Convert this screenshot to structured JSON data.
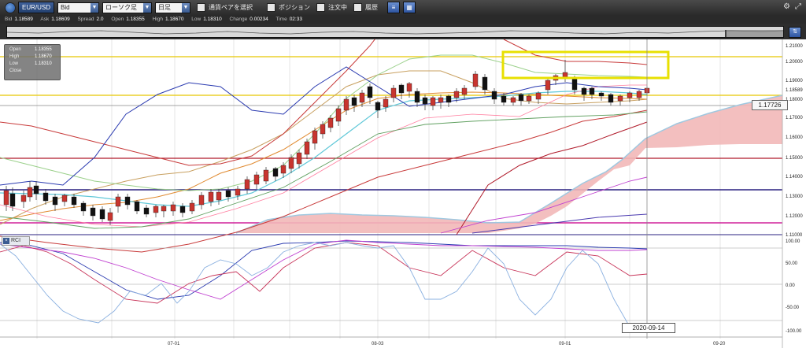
{
  "toolbar": {
    "symbol": "EUR/USD",
    "price_type": "Bid",
    "chart_type": "ローソク足",
    "period": "日足",
    "select_pair_label": "通貨ペアを選択",
    "position_label": "ポジション",
    "order_label": "注文中",
    "history_label": "履歴"
  },
  "quote": [
    {
      "label": "Bid",
      "value": "1.18589"
    },
    {
      "label": "Ask",
      "value": "1.18609"
    },
    {
      "label": "Spread",
      "value": "2.0"
    },
    {
      "label": "Open",
      "value": "1.18355"
    },
    {
      "label": "High",
      "value": "1.18670"
    },
    {
      "label": "Low",
      "value": "1.18310"
    },
    {
      "label": "Change",
      "value": "0.00234"
    },
    {
      "label": "Time",
      "value": "02:33"
    }
  ],
  "ohlc": {
    "open_label": "Open",
    "open": "1.18355",
    "high_label": "High",
    "high": "1.18670",
    "low_label": "Low",
    "low": "1.18310",
    "close_label": "Close",
    "close": ""
  },
  "price_axis": [
    "1.21000",
    "1.20000",
    "1.19000",
    "1.18589",
    "1.18000",
    "1.17000",
    "1.16000",
    "1.15000",
    "1.14000",
    "1.13000",
    "1.12000",
    "1.11000"
  ],
  "rci_axis": [
    "100.00",
    "50.00",
    "0.00",
    "-50.00",
    "-100.00"
  ],
  "date_axis": [
    "07-01",
    "08-03",
    "09-01",
    "09-20"
  ],
  "rci_label": "RCI",
  "crosshair_price": "1.17726",
  "crosshair_date": "2020-09-14",
  "colors": {
    "bull": "#c8352f",
    "bear": "#111111",
    "kumo": "#f2b8b8",
    "highlight_box": "#e8e000"
  }
}
